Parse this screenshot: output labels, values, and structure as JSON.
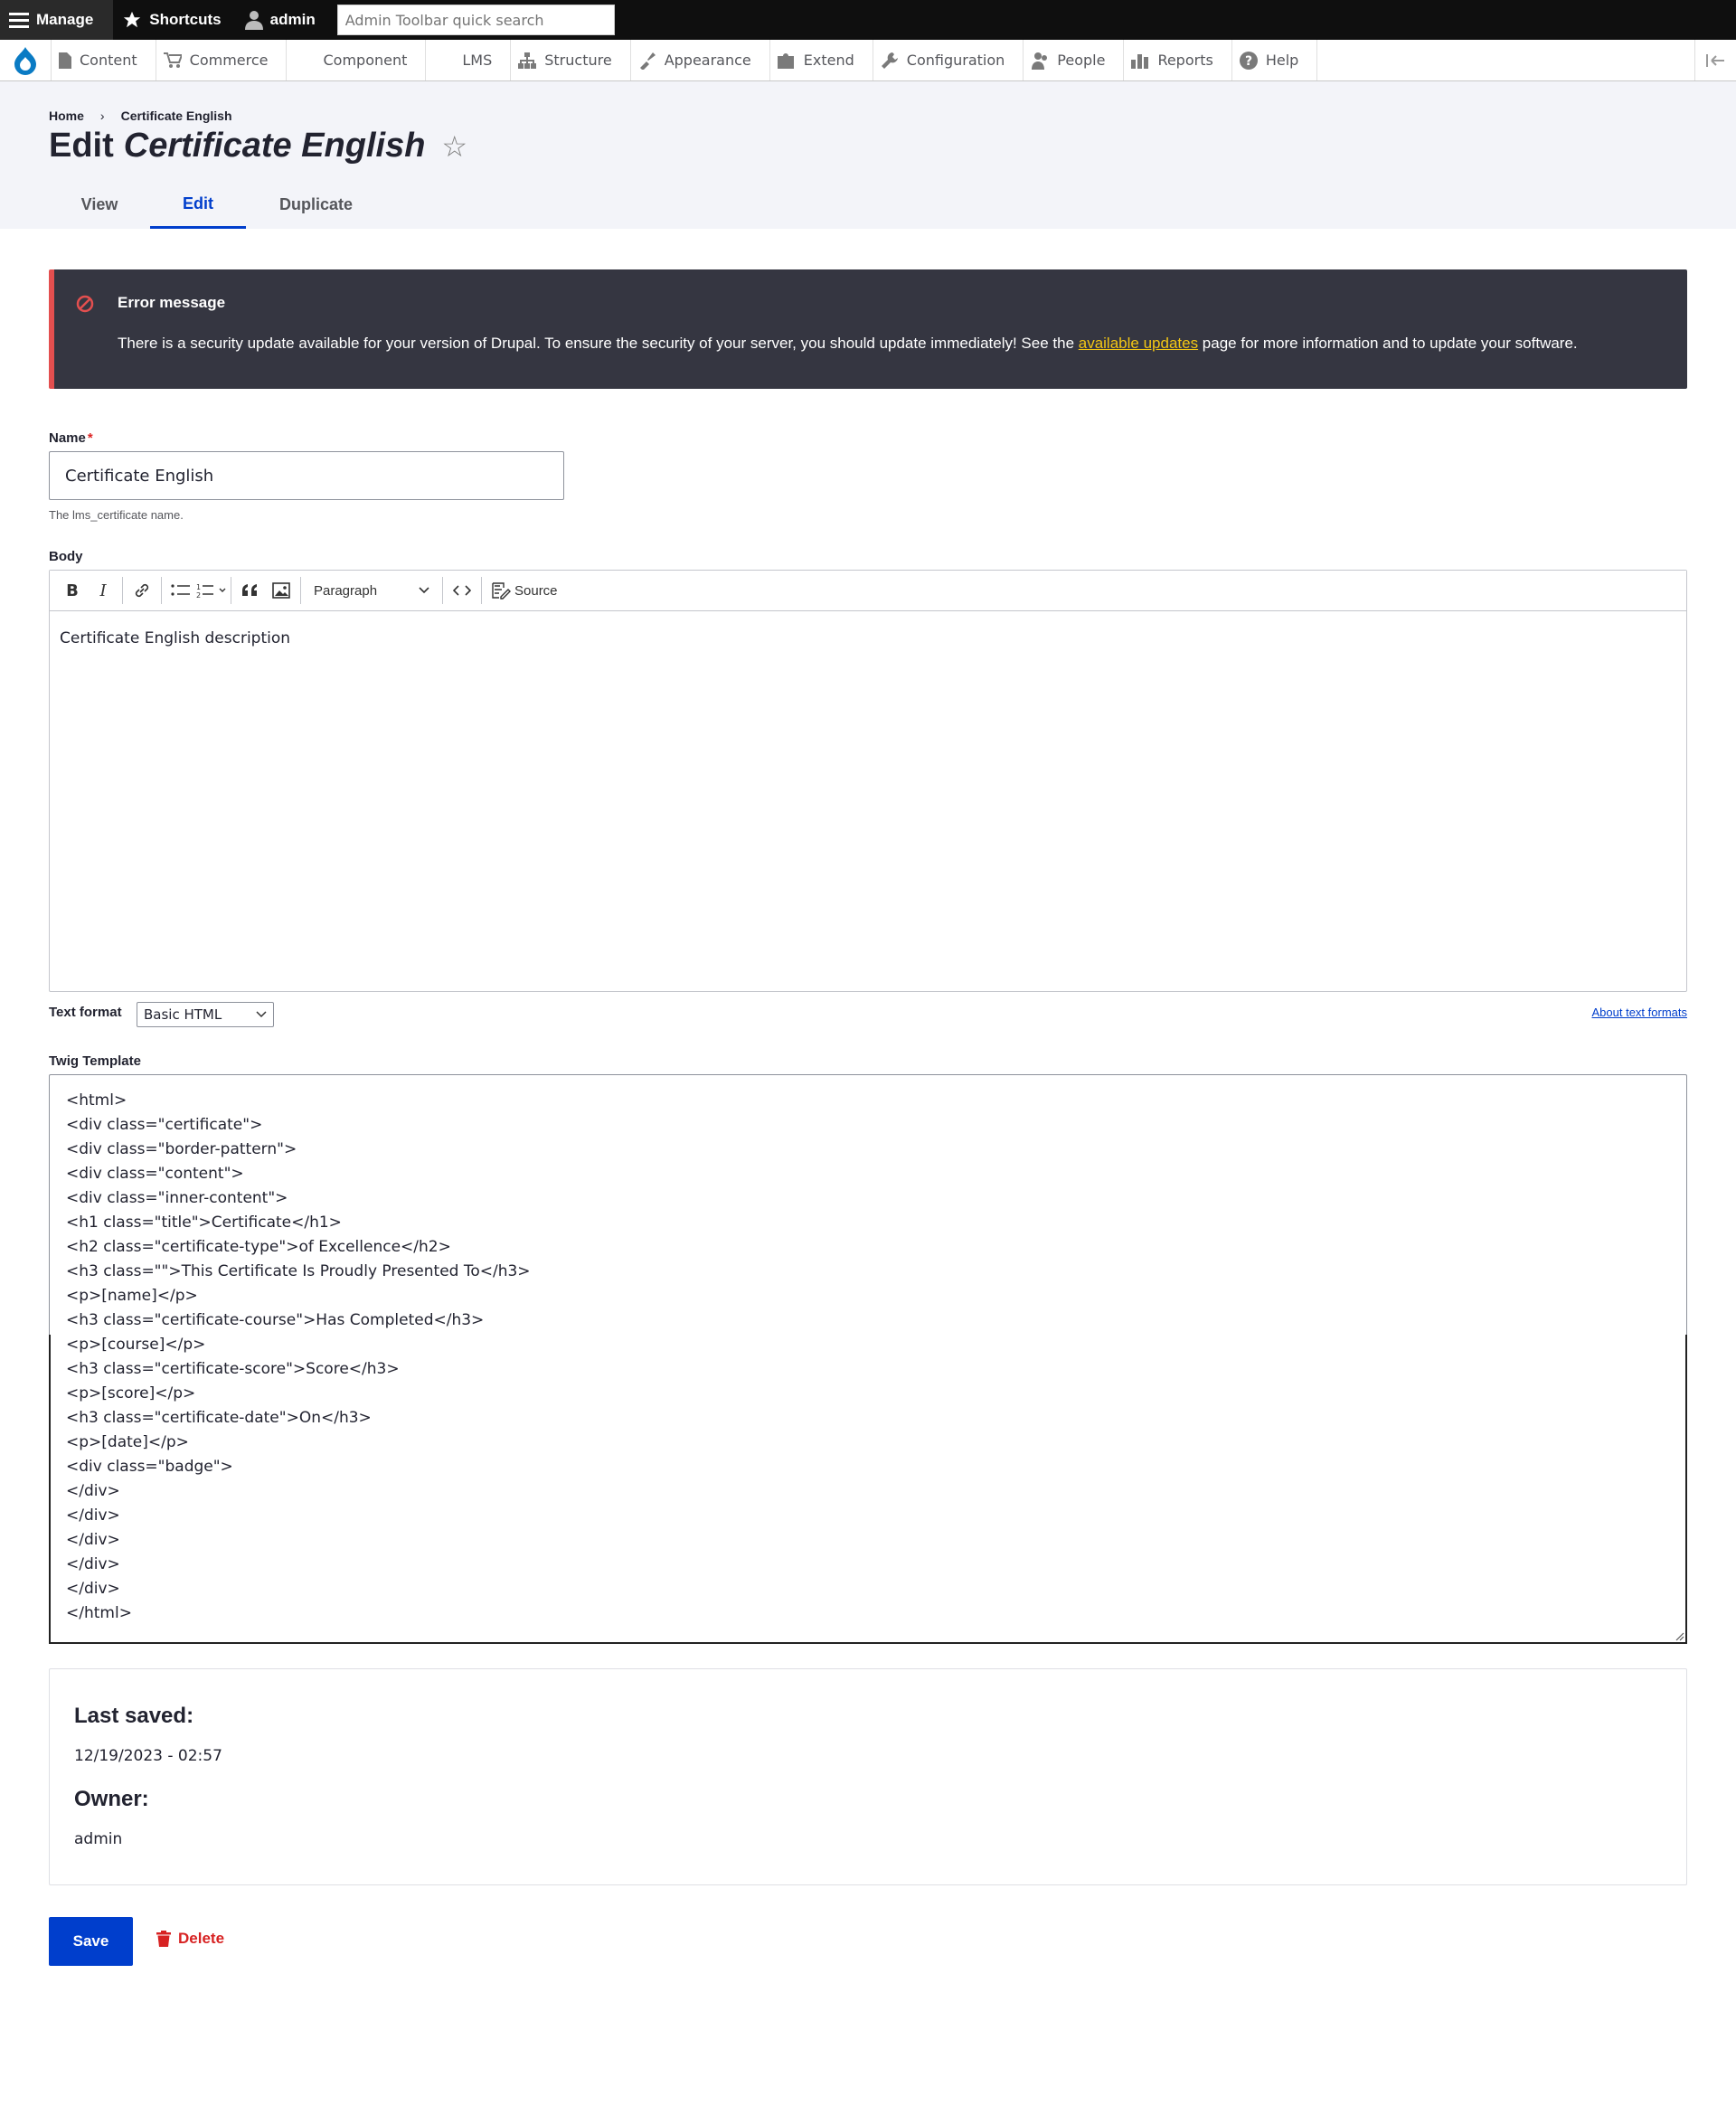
{
  "admin_bar": {
    "manage": "Manage",
    "shortcuts": "Shortcuts",
    "user": "admin",
    "search_placeholder": "Admin Toolbar quick search"
  },
  "tray": {
    "items": [
      "Content",
      "Commerce",
      "Component",
      "LMS",
      "Structure",
      "Appearance",
      "Extend",
      "Configuration",
      "People",
      "Reports",
      "Help"
    ]
  },
  "breadcrumb": [
    "Home",
    "Certificate English"
  ],
  "title": {
    "prefix": "Edit",
    "entity": "Certificate English"
  },
  "tabs": [
    "View",
    "Edit",
    "Duplicate"
  ],
  "error": {
    "title": "Error message",
    "text_before": "There is a security update available for your version of Drupal. To ensure the security of your server, you should update immediately! See the ",
    "link": "available updates",
    "text_after": " page for more information and to update your software."
  },
  "form": {
    "name_label": "Name",
    "name_value": "Certificate English",
    "name_desc": "The lms_certificate name.",
    "body_label": "Body",
    "paragraph": "Paragraph",
    "source": "Source",
    "body_content": "Certificate English description",
    "text_format_label": "Text format",
    "text_format_value": "Basic HTML",
    "about_text_formats": "About text formats",
    "twig_label": "Twig Template",
    "twig_lines": [
      "<html>",
      "<div class=\"certificate\">",
      "<div class=\"border-pattern\">",
      "<div class=\"content\">",
      "<div class=\"inner-content\">",
      "<h1 class=\"title\">Certificate</h1>",
      "<h2 class=\"certificate-type\">of Excellence</h2>",
      "<h3 class=\"\">This Certificate Is Proudly Presented To</h3>",
      "<p>[name]</p>",
      "<h3 class=\"certificate-course\">Has Completed</h3>",
      "<p>[course]</p>",
      "<h3 class=\"certificate-score\">Score</h3>",
      "<p>[score]</p>",
      "<h3 class=\"certificate-date\">On</h3>",
      "<p>[date]</p>",
      "<div class=\"badge\">",
      "</div>",
      "</div>",
      "</div>",
      "</div>",
      "</div>",
      "</html>"
    ]
  },
  "meta": {
    "last_saved_label": "Last saved:",
    "last_saved_value": "12/19/2023 - 02:57",
    "owner_label": "Owner:",
    "owner_value": "admin"
  },
  "actions": {
    "save": "Save",
    "delete": "Delete"
  },
  "colors": {
    "accent": "#003ecc",
    "error_bg": "#353641",
    "error_border": "#e34f4f",
    "link_warning": "#f3c614",
    "danger": "#d72222"
  }
}
